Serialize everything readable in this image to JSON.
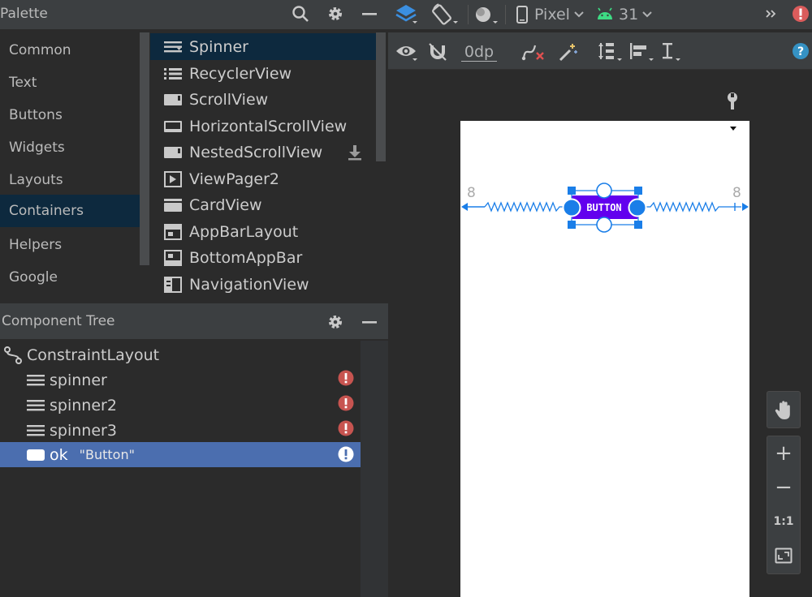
{
  "palette": {
    "title": "Palette",
    "header_icons": [
      "search-icon",
      "gear-icon",
      "minimize-icon"
    ],
    "categories": [
      {
        "label": "Common",
        "selected": false
      },
      {
        "label": "Text",
        "selected": false
      },
      {
        "label": "Buttons",
        "selected": false
      },
      {
        "label": "Widgets",
        "selected": false
      },
      {
        "label": "Layouts",
        "selected": false
      },
      {
        "label": "Containers",
        "selected": true
      },
      {
        "label": "Helpers",
        "selected": false
      },
      {
        "label": "Google",
        "selected": false
      }
    ],
    "items": [
      {
        "label": "Spinner",
        "icon": "spinner-icon",
        "selected": true
      },
      {
        "label": "RecyclerView",
        "icon": "list-icon",
        "selected": false
      },
      {
        "label": "ScrollView",
        "icon": "scrollview-icon",
        "selected": false
      },
      {
        "label": "HorizontalScrollView",
        "icon": "horizontal-scroll-icon",
        "selected": false
      },
      {
        "label": "NestedScrollView",
        "icon": "scrollview-icon",
        "selected": false
      },
      {
        "label": "ViewPager2",
        "icon": "viewpager-icon",
        "selected": false
      },
      {
        "label": "CardView",
        "icon": "cardview-icon",
        "selected": false
      },
      {
        "label": "AppBarLayout",
        "icon": "appbar-icon",
        "selected": false
      },
      {
        "label": "BottomAppBar",
        "icon": "bottom-appbar-icon",
        "selected": false
      },
      {
        "label": "NavigationView",
        "icon": "navigationview-icon",
        "selected": false
      }
    ]
  },
  "component_tree": {
    "title": "Component Tree",
    "nodes": [
      {
        "label": "ConstraintLayout",
        "sub": "",
        "icon": "constraint-layout-icon",
        "warning": false,
        "selected": false
      },
      {
        "label": "spinner",
        "sub": "",
        "icon": "spinner-icon",
        "warning": true,
        "selected": false
      },
      {
        "label": "spinner2",
        "sub": "",
        "icon": "spinner-icon",
        "warning": true,
        "selected": false
      },
      {
        "label": "spinner3",
        "sub": "",
        "icon": "spinner-icon",
        "warning": true,
        "selected": false
      },
      {
        "label": "ok",
        "sub": "\"Button\"",
        "icon": "button-icon",
        "warning": true,
        "selected": true
      }
    ]
  },
  "toolbar": {
    "device": "Pixel",
    "api_level": "31",
    "margin_value": "0dp",
    "icons": [
      "layers-icon",
      "orientation-icon",
      "theme-icon",
      "phone-icon",
      "android-icon",
      "overflow-icon",
      "error-icon"
    ],
    "tools": [
      "eye-icon",
      "magnet-off-icon",
      "clear-constraints-icon",
      "magic-wand-icon",
      "pack-icon",
      "align-icon",
      "guidelines-icon",
      "help-icon"
    ]
  },
  "canvas": {
    "button_text": "BUTTON",
    "left_margin": "8",
    "right_margin": "8"
  },
  "zoom": {
    "zoom_in": "+",
    "zoom_out": "−",
    "actual_size": "1:1"
  },
  "colors": {
    "selection": "#0d293e",
    "tree_selection": "#4b6eaf",
    "warning_red": "#c75450",
    "constraint_blue": "#1a7ee8",
    "button_purple": "#6200ee"
  }
}
